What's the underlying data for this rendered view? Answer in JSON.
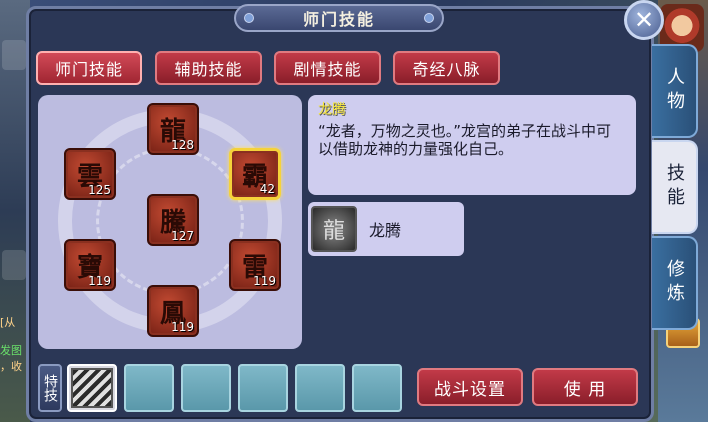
{
  "window": {
    "title": "师门技能",
    "close_glyph": "✕"
  },
  "tabs": [
    {
      "label": "师门技能",
      "active": true
    },
    {
      "label": "辅助技能",
      "active": false
    },
    {
      "label": "剧情技能",
      "active": false
    },
    {
      "label": "奇经八脉",
      "active": false
    }
  ],
  "side_tabs": [
    {
      "label": "人物",
      "active": false
    },
    {
      "label": "技能",
      "active": true
    },
    {
      "label": "修炼",
      "active": false
    }
  ],
  "skills": [
    {
      "glyph": "龍",
      "level": "128",
      "selected": false
    },
    {
      "glyph": "雲",
      "level": "125",
      "selected": false
    },
    {
      "glyph": "霸",
      "level": "42",
      "selected": true
    },
    {
      "glyph": "騰",
      "level": "127",
      "selected": false
    },
    {
      "glyph": "寶",
      "level": "119",
      "selected": false
    },
    {
      "glyph": "雷",
      "level": "119",
      "selected": false
    },
    {
      "glyph": "鳳",
      "level": "119",
      "selected": false
    }
  ],
  "description": {
    "name": "龙腾",
    "text": "“龙者，万物之灵也。”龙宫的弟子在战斗中可以借助龙神的力量强化自己。"
  },
  "sub_skill": {
    "label": "龙腾",
    "icon": "dragon-icon",
    "glyph": "龍"
  },
  "bottom": {
    "special_label": "特技",
    "use_label": "使 用",
    "battle_settings_label": "战斗设置"
  },
  "background": {
    "left_texts": [
      "[从",
      "发图",
      "，收"
    ]
  }
}
